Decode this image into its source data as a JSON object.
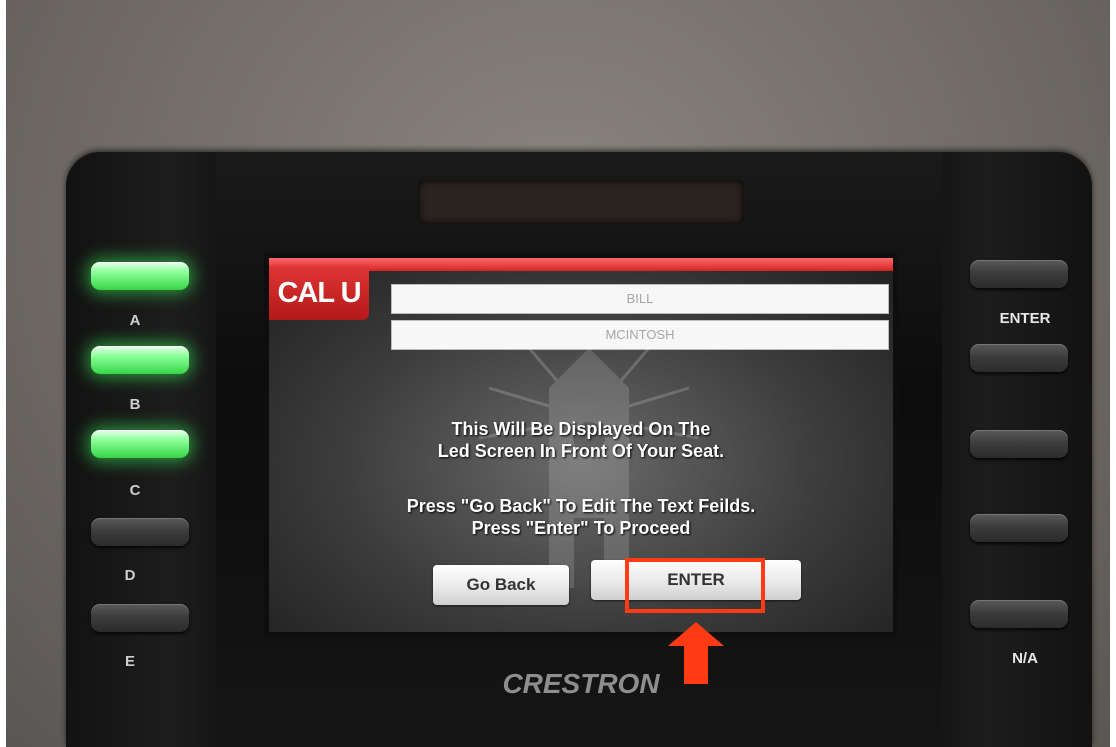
{
  "device": {
    "brand": "CRESTRON",
    "left_buttons": [
      {
        "label": "A",
        "lit": true
      },
      {
        "label": "B",
        "lit": true
      },
      {
        "label": "C",
        "lit": true
      },
      {
        "label": "D",
        "lit": false
      },
      {
        "label": "E",
        "lit": false
      }
    ],
    "right_labels": {
      "enter": "ENTER",
      "na": "N/A"
    }
  },
  "screen": {
    "logo_text": "CAL U",
    "first_name": "BILL",
    "last_name": "MCINTOSH",
    "message_line1": "This Will Be Displayed On The",
    "message_line2": "Led Screen In Front Of Your Seat.",
    "instruction_line1": "Press \"Go Back\" To Edit The Text Feilds.",
    "instruction_line2": "Press \"Enter\" To Proceed",
    "go_back_label": "Go Back",
    "enter_label": "ENTER"
  },
  "colors": {
    "accent_red": "#d32424",
    "led_green": "#37d548",
    "annotation": "#ff3b14"
  }
}
